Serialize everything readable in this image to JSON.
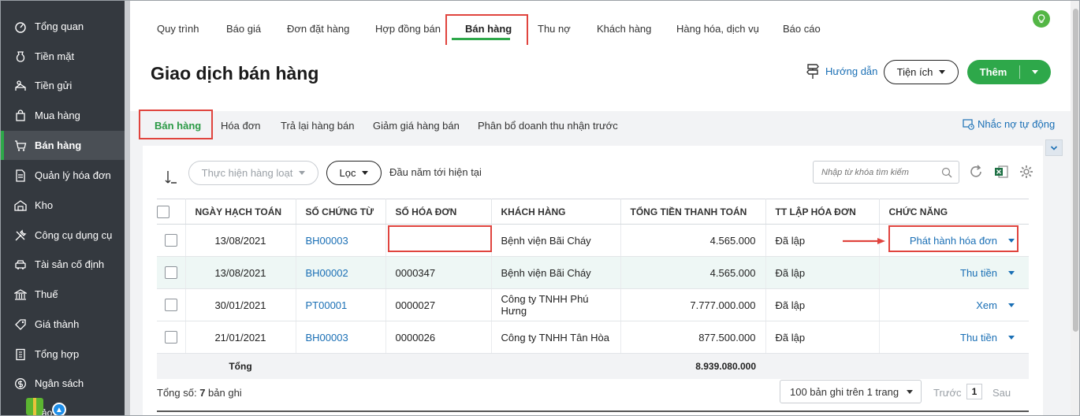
{
  "sidebar": {
    "items": [
      {
        "label": "Tổng quan",
        "icon": "dashboard-icon"
      },
      {
        "label": "Tiền mặt",
        "icon": "cash-icon"
      },
      {
        "label": "Tiền gửi",
        "icon": "bank-icon"
      },
      {
        "label": "Mua hàng",
        "icon": "purchase-bag-icon"
      },
      {
        "label": "Bán hàng",
        "icon": "cart-icon",
        "active": true
      },
      {
        "label": "Quản lý hóa đơn",
        "icon": "invoice-icon"
      },
      {
        "label": "Kho",
        "icon": "warehouse-icon"
      },
      {
        "label": "Công cụ dụng cụ",
        "icon": "tools-icon"
      },
      {
        "label": "Tài sản cố định",
        "icon": "asset-icon"
      },
      {
        "label": "Thuế",
        "icon": "tax-icon"
      },
      {
        "label": "Giá thành",
        "icon": "price-tag-icon"
      },
      {
        "label": "Tổng hợp",
        "icon": "summary-icon"
      },
      {
        "label": "Ngân sách",
        "icon": "budget-icon"
      }
    ],
    "bottom_text": "ảo"
  },
  "topnav": {
    "tabs": [
      "Quy trình",
      "Báo giá",
      "Đơn đặt hàng",
      "Hợp đồng bán",
      "Bán hàng",
      "Thu nợ",
      "Khách hàng",
      "Hàng hóa, dịch vụ",
      "Báo cáo"
    ],
    "active_index": 4
  },
  "header": {
    "title": "Giao dịch bán hàng",
    "guide_label": "Hướng dẫn",
    "utility_label": "Tiện ích",
    "add_label": "Thêm"
  },
  "subtabs": {
    "items": [
      "Bán hàng",
      "Hóa đơn",
      "Trả lại hàng bán",
      "Giảm giá hàng bán",
      "Phân bổ doanh thu nhận trước"
    ],
    "active_index": 0,
    "remind_label": "Nhắc nợ tự động"
  },
  "toolbar": {
    "batch_label": "Thực hiện hàng loạt",
    "filter_label": "Lọc",
    "period_label": "Đầu năm tới hiện tại",
    "search_placeholder": "Nhập từ khóa tìm kiếm"
  },
  "table": {
    "columns": [
      "NGÀY HẠCH TOÁN",
      "SỐ CHỨNG TỪ",
      "SỐ HÓA ĐƠN",
      "KHÁCH HÀNG",
      "TỔNG TIỀN THANH TOÁN",
      "TT LẬP HÓA ĐƠN",
      "CHỨC NĂNG"
    ],
    "rows": [
      {
        "date": "13/08/2021",
        "voucher": "BH00003",
        "invoice": "",
        "customer": "Bệnh viện Bãi Cháy",
        "total": "4.565.000",
        "status": "Đã lập",
        "action": "Phát hành hóa đơn"
      },
      {
        "date": "13/08/2021",
        "voucher": "BH00002",
        "invoice": "0000347",
        "customer": "Bệnh viện Bãi Cháy",
        "total": "4.565.000",
        "status": "Đã lập",
        "action": "Thu tiền"
      },
      {
        "date": "30/01/2021",
        "voucher": "PT00001",
        "invoice": "0000027",
        "customer": "Công ty TNHH Phú Hưng",
        "total": "7.777.000.000",
        "status": "Đã lập",
        "action": "Xem"
      },
      {
        "date": "21/01/2021",
        "voucher": "BH00003",
        "invoice": "0000026",
        "customer": "Công ty TNHH Tân Hòa",
        "total": "877.500.000",
        "status": "Đã lập",
        "action": "Thu tiền"
      }
    ],
    "total_label": "Tổng",
    "total_value": "8.939.080.000"
  },
  "footer": {
    "count_prefix": "Tổng số: ",
    "count_value": "7",
    "count_suffix": " bản ghi",
    "page_size_label": "100 bản ghi trên 1 trang",
    "prev_label": "Trước",
    "page_number": "1",
    "next_label": "Sau"
  },
  "colors": {
    "sidebar_bg": "#34393f",
    "accent_green": "#2ea84a",
    "link_blue": "#1a6fb5",
    "highlight_red": "#e0443e"
  }
}
